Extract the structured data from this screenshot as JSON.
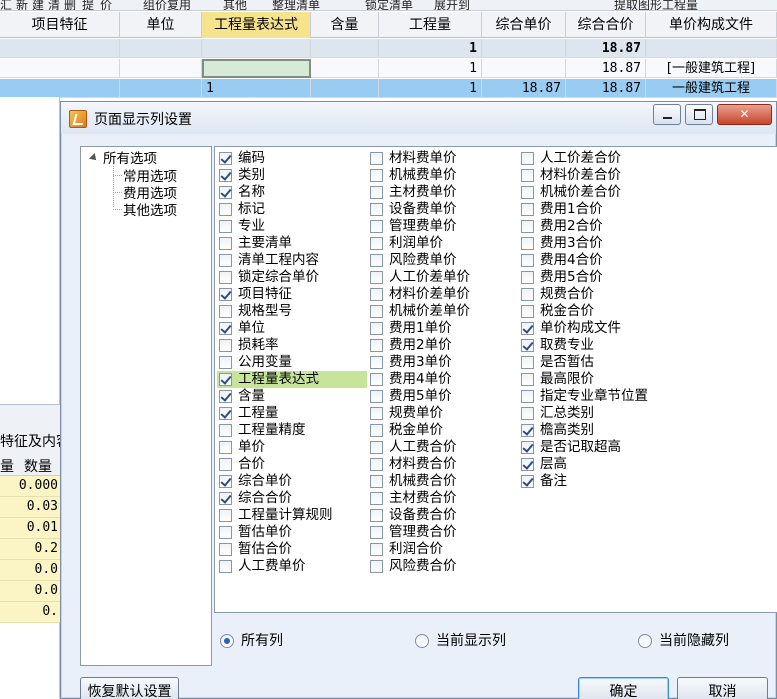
{
  "toolbar": {
    "items": [
      "汇",
      "新",
      "建",
      "清",
      "删",
      "提",
      "价",
      "组价复用",
      "其他",
      "整理清单",
      "锁定清单",
      "展开到",
      "提取图形工程量"
    ]
  },
  "grid": {
    "columns": [
      "项目特征",
      "单位",
      "工程量表达式",
      "含量",
      "工程量",
      "综合单价",
      "综合合价",
      "单价构成文件"
    ],
    "rows": [
      {
        "expr": "",
        "qty": "1",
        "unit_price": "",
        "total": "18.87",
        "file": ""
      },
      {
        "expr": "",
        "qty": "1",
        "unit_price": "",
        "total": "18.87",
        "file": "[一般建筑工程]"
      },
      {
        "expr": "1",
        "qty": "1",
        "unit_price": "18.87",
        "total": "18.87",
        "file": "一般建筑工程"
      }
    ]
  },
  "left_pane": {
    "sub_title": "特征及内容",
    "col_heads": [
      "量",
      "数量"
    ],
    "numbers": [
      "0.000",
      "0.03",
      "0.01",
      "0.2",
      "0.0",
      "0.0",
      "0."
    ]
  },
  "dialog": {
    "title": "页面显示列设置",
    "tree": {
      "root": "所有选项",
      "children": [
        "常用选项",
        "费用选项",
        "其他选项"
      ]
    },
    "options": {
      "col1": [
        {
          "label": "编码",
          "checked": true
        },
        {
          "label": "类别",
          "checked": true
        },
        {
          "label": "名称",
          "checked": true
        },
        {
          "label": "标记",
          "checked": false
        },
        {
          "label": "专业",
          "checked": false
        },
        {
          "label": "主要清单",
          "checked": false
        },
        {
          "label": "清单工程内容",
          "checked": false
        },
        {
          "label": "锁定综合单价",
          "checked": false
        },
        {
          "label": "项目特征",
          "checked": true
        },
        {
          "label": "规格型号",
          "checked": false
        },
        {
          "label": "单位",
          "checked": true
        },
        {
          "label": "损耗率",
          "checked": false
        },
        {
          "label": "公用变量",
          "checked": false
        },
        {
          "label": "工程量表达式",
          "checked": true,
          "highlight": true
        },
        {
          "label": "含量",
          "checked": true
        },
        {
          "label": "工程量",
          "checked": true
        },
        {
          "label": "工程量精度",
          "checked": false
        },
        {
          "label": "单价",
          "checked": false
        },
        {
          "label": "合价",
          "checked": false
        },
        {
          "label": "综合单价",
          "checked": true
        },
        {
          "label": "综合合价",
          "checked": true
        },
        {
          "label": "工程量计算规则",
          "checked": false
        },
        {
          "label": "暂估单价",
          "checked": false
        },
        {
          "label": "暂估合价",
          "checked": false
        },
        {
          "label": "人工费单价",
          "checked": false
        }
      ],
      "col2": [
        {
          "label": "材料费单价",
          "checked": false
        },
        {
          "label": "机械费单价",
          "checked": false
        },
        {
          "label": "主材费单价",
          "checked": false
        },
        {
          "label": "设备费单价",
          "checked": false
        },
        {
          "label": "管理费单价",
          "checked": false
        },
        {
          "label": "利润单价",
          "checked": false
        },
        {
          "label": "风险费单价",
          "checked": false
        },
        {
          "label": "人工价差单价",
          "checked": false
        },
        {
          "label": "材料价差单价",
          "checked": false
        },
        {
          "label": "机械价差单价",
          "checked": false
        },
        {
          "label": "费用1单价",
          "checked": false
        },
        {
          "label": "费用2单价",
          "checked": false
        },
        {
          "label": "费用3单价",
          "checked": false
        },
        {
          "label": "费用4单价",
          "checked": false
        },
        {
          "label": "费用5单价",
          "checked": false
        },
        {
          "label": "规费单价",
          "checked": false
        },
        {
          "label": "税金单价",
          "checked": false
        },
        {
          "label": "人工费合价",
          "checked": false
        },
        {
          "label": "材料费合价",
          "checked": false
        },
        {
          "label": "机械费合价",
          "checked": false
        },
        {
          "label": "主材费合价",
          "checked": false
        },
        {
          "label": "设备费合价",
          "checked": false
        },
        {
          "label": "管理费合价",
          "checked": false
        },
        {
          "label": "利润合价",
          "checked": false
        },
        {
          "label": "风险费合价",
          "checked": false
        }
      ],
      "col3": [
        {
          "label": "人工价差合价",
          "checked": false
        },
        {
          "label": "材料价差合价",
          "checked": false
        },
        {
          "label": "机械价差合价",
          "checked": false
        },
        {
          "label": "费用1合价",
          "checked": false
        },
        {
          "label": "费用2合价",
          "checked": false
        },
        {
          "label": "费用3合价",
          "checked": false
        },
        {
          "label": "费用4合价",
          "checked": false
        },
        {
          "label": "费用5合价",
          "checked": false
        },
        {
          "label": "规费合价",
          "checked": false
        },
        {
          "label": "税金合价",
          "checked": false
        },
        {
          "label": "单价构成文件",
          "checked": true
        },
        {
          "label": "取费专业",
          "checked": true
        },
        {
          "label": "是否暂估",
          "checked": false
        },
        {
          "label": "最高限价",
          "checked": false
        },
        {
          "label": "指定专业章节位置",
          "checked": false
        },
        {
          "label": "汇总类别",
          "checked": false
        },
        {
          "label": "檐高类别",
          "checked": true
        },
        {
          "label": "是否记取超高",
          "checked": true
        },
        {
          "label": "层高",
          "checked": true
        },
        {
          "label": "备注",
          "checked": true
        }
      ]
    },
    "radios": [
      {
        "label": "所有列",
        "selected": true
      },
      {
        "label": "当前显示列",
        "selected": false
      },
      {
        "label": "当前隐藏列",
        "selected": false
      }
    ],
    "buttons": {
      "restore": "恢复默认设置",
      "ok": "确定",
      "cancel": "取消"
    }
  },
  "colors": {
    "highlight_row": "#99ccf2",
    "selected_header": "#f6e38e",
    "option_highlight": "#c6e59b",
    "dialog_bg": "#eaf0f9"
  },
  "icons": [
    "app-icon",
    "minimize-icon",
    "maximize-icon",
    "close-icon",
    "tree-expand-icon"
  ]
}
